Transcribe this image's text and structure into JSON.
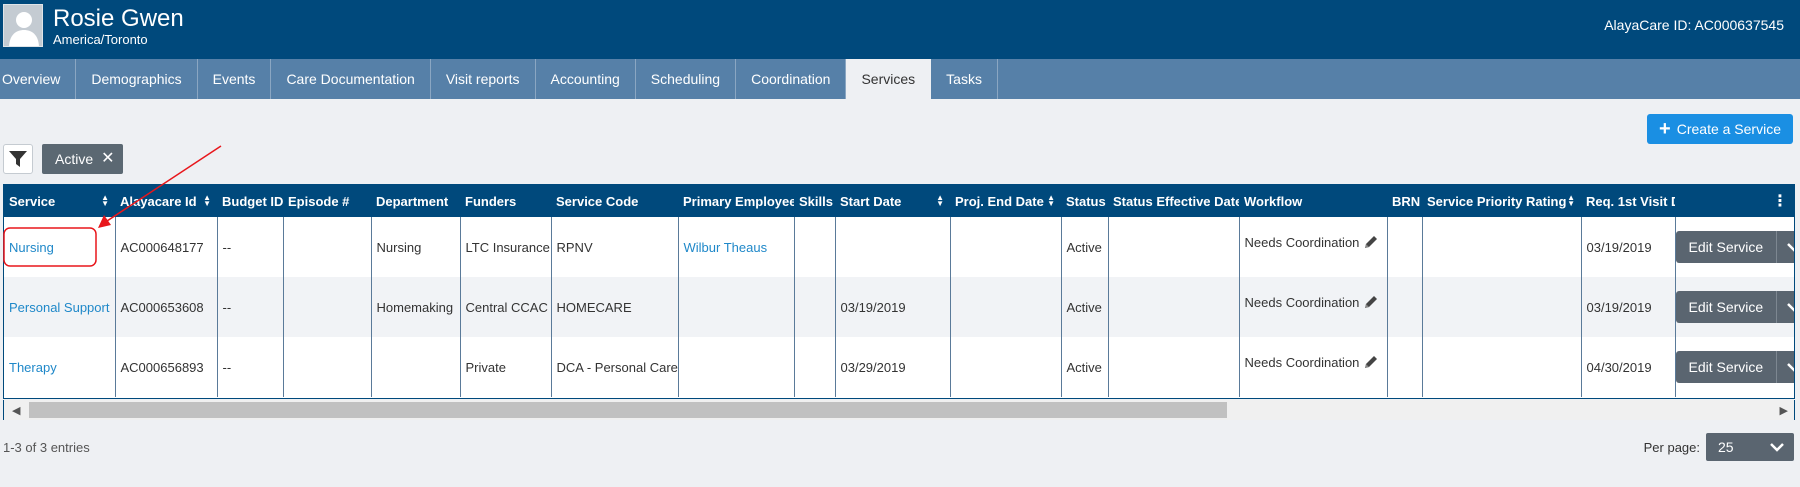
{
  "header": {
    "client_name": "Rosie Gwen",
    "timezone": "America/Toronto",
    "alaya_id": "AlayaCare ID: AC000637545",
    "avatar_icon": "user-silhouette-icon",
    "background_color": "#00497c"
  },
  "tabs": [
    {
      "label": "Overview",
      "active": false
    },
    {
      "label": "Demographics",
      "active": false
    },
    {
      "label": "Events",
      "active": false
    },
    {
      "label": "Care Documentation",
      "active": false
    },
    {
      "label": "Visit reports",
      "active": false
    },
    {
      "label": "Accounting",
      "active": false
    },
    {
      "label": "Scheduling",
      "active": false
    },
    {
      "label": "Coordination",
      "active": false
    },
    {
      "label": "Services",
      "active": true
    },
    {
      "label": "Tasks",
      "active": false
    }
  ],
  "toolbar": {
    "create_label": "Create a Service",
    "filter_icon": "funnel-icon",
    "active_filter_label": "Active"
  },
  "table": {
    "columns": [
      "Service",
      "Alayacare Id",
      "Budget ID",
      "Episode #",
      "Department",
      "Funders",
      "Service Code",
      "Primary Employee",
      "Skills",
      "Start Date",
      "Proj. End Date",
      "Status",
      "Status Effective Date",
      "Workflow",
      "BRN",
      "Service Priority Rating",
      "Req. 1st Visit D"
    ],
    "sortable": [
      true,
      true,
      false,
      false,
      false,
      false,
      false,
      false,
      false,
      true,
      true,
      false,
      false,
      false,
      false,
      true,
      true
    ],
    "rows": [
      [
        "Nursing",
        "AC000648177",
        "--",
        "",
        "Nursing",
        "LTC Insurance",
        "RPNV",
        "Wilbur Theaus",
        "",
        "",
        "",
        "Active",
        "",
        "Needs Coordination",
        "",
        "",
        "03/19/2019"
      ],
      [
        "Personal Support",
        "AC000653608",
        "--",
        "",
        "Homemaking",
        "Central CCAC",
        "HOMECARE",
        "",
        "",
        "03/19/2019",
        "",
        "Active",
        "",
        "Needs Coordination",
        "",
        "",
        "03/19/2019"
      ],
      [
        "Therapy",
        "AC000656893",
        "--",
        "",
        "",
        "Private",
        "DCA - Personal Care",
        "",
        "",
        "03/29/2019",
        "",
        "Active",
        "",
        "Needs Coordination",
        "",
        "",
        "04/30/2019"
      ]
    ],
    "edit_label": "Edit Service",
    "column_menu_icon": "vertical-dots-icon"
  },
  "footer": {
    "entries_text": "1-3 of 3 entries",
    "per_page_label": "Per page:",
    "per_page_value": "25"
  },
  "colors": {
    "header": "#00497c",
    "tabs": "#5680a8",
    "link": "#1f88c9",
    "primary_button": "#1a8fe3",
    "annotation": "#e8161b"
  }
}
